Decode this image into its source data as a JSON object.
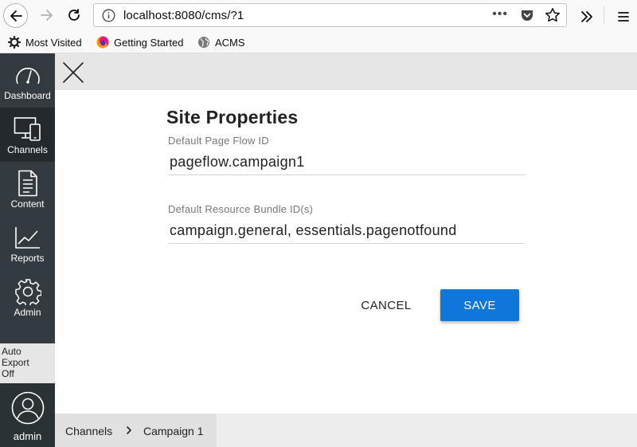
{
  "browser": {
    "url": "localhost:8080/cms/?1",
    "url_more": "•••",
    "bookmarks": [
      {
        "label": "Most Visited",
        "icon": "gear-icon"
      },
      {
        "label": "Getting Started",
        "icon": "firefox-icon"
      },
      {
        "label": "ACMS",
        "icon": "globe-icon"
      }
    ]
  },
  "sidebar": {
    "items": [
      {
        "label": "Dashboard",
        "icon": "dashboard-gauge-icon",
        "active": false
      },
      {
        "label": "Channels",
        "icon": "devices-icon",
        "active": true
      },
      {
        "label": "Content",
        "icon": "document-icon",
        "active": false
      },
      {
        "label": "Reports",
        "icon": "line-chart-icon",
        "active": false
      },
      {
        "label": "Admin",
        "icon": "gear-icon",
        "active": false
      }
    ],
    "auto_export": {
      "line1": "Auto",
      "line2": "Export",
      "line3": "Off"
    },
    "user": {
      "name": "admin",
      "icon": "user-avatar-icon"
    }
  },
  "form": {
    "title": "Site Properties",
    "fields": [
      {
        "label": "Default Page Flow ID",
        "value": "pageflow.campaign1"
      },
      {
        "label": "Default Resource Bundle ID(s)",
        "value": "campaign.general, essentials.pagenotfound"
      }
    ],
    "cancel_label": "CANCEL",
    "save_label": "SAVE"
  },
  "breadcrumb": {
    "items": [
      "Channels",
      "Campaign 1"
    ],
    "separator": "›"
  },
  "colors": {
    "sidebar_bg": "#333b40",
    "sidebar_active": "#23292c",
    "primary": "#0f77d9",
    "topbar_bg": "#e6e6e6"
  }
}
